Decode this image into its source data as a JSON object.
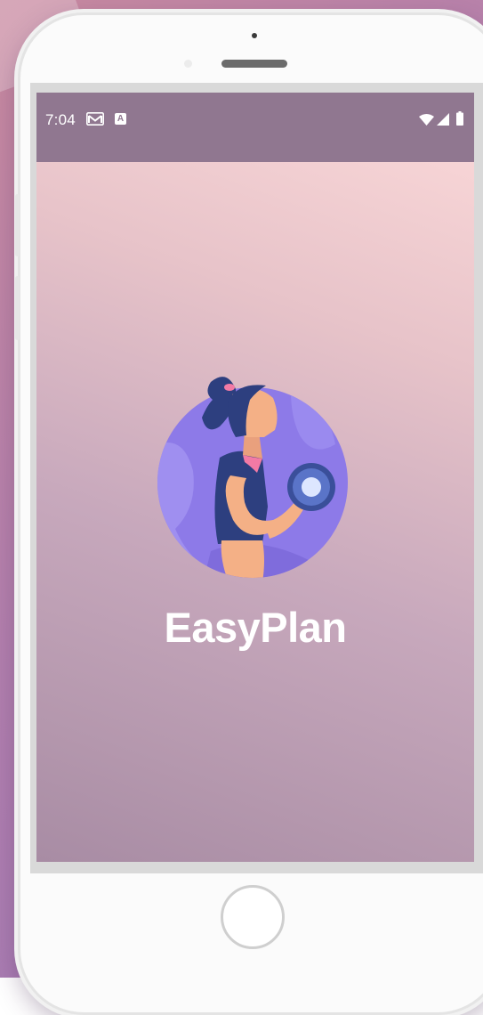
{
  "status_bar": {
    "time": "7:04",
    "icons": [
      "gmail-icon",
      "a-notification-icon",
      "wifi-icon",
      "signal-icon",
      "battery-icon"
    ],
    "a_label": "A"
  },
  "splash": {
    "app_name": "EasyPlan",
    "logo_icon": "woman-lifting-dumbbell-icon"
  },
  "colors": {
    "status_bar": "#907790",
    "gradient_top": "#fcdada",
    "gradient_bottom": "#a88ca4",
    "logo_circle": "#8b78e6",
    "app_name": "#ffffff"
  }
}
